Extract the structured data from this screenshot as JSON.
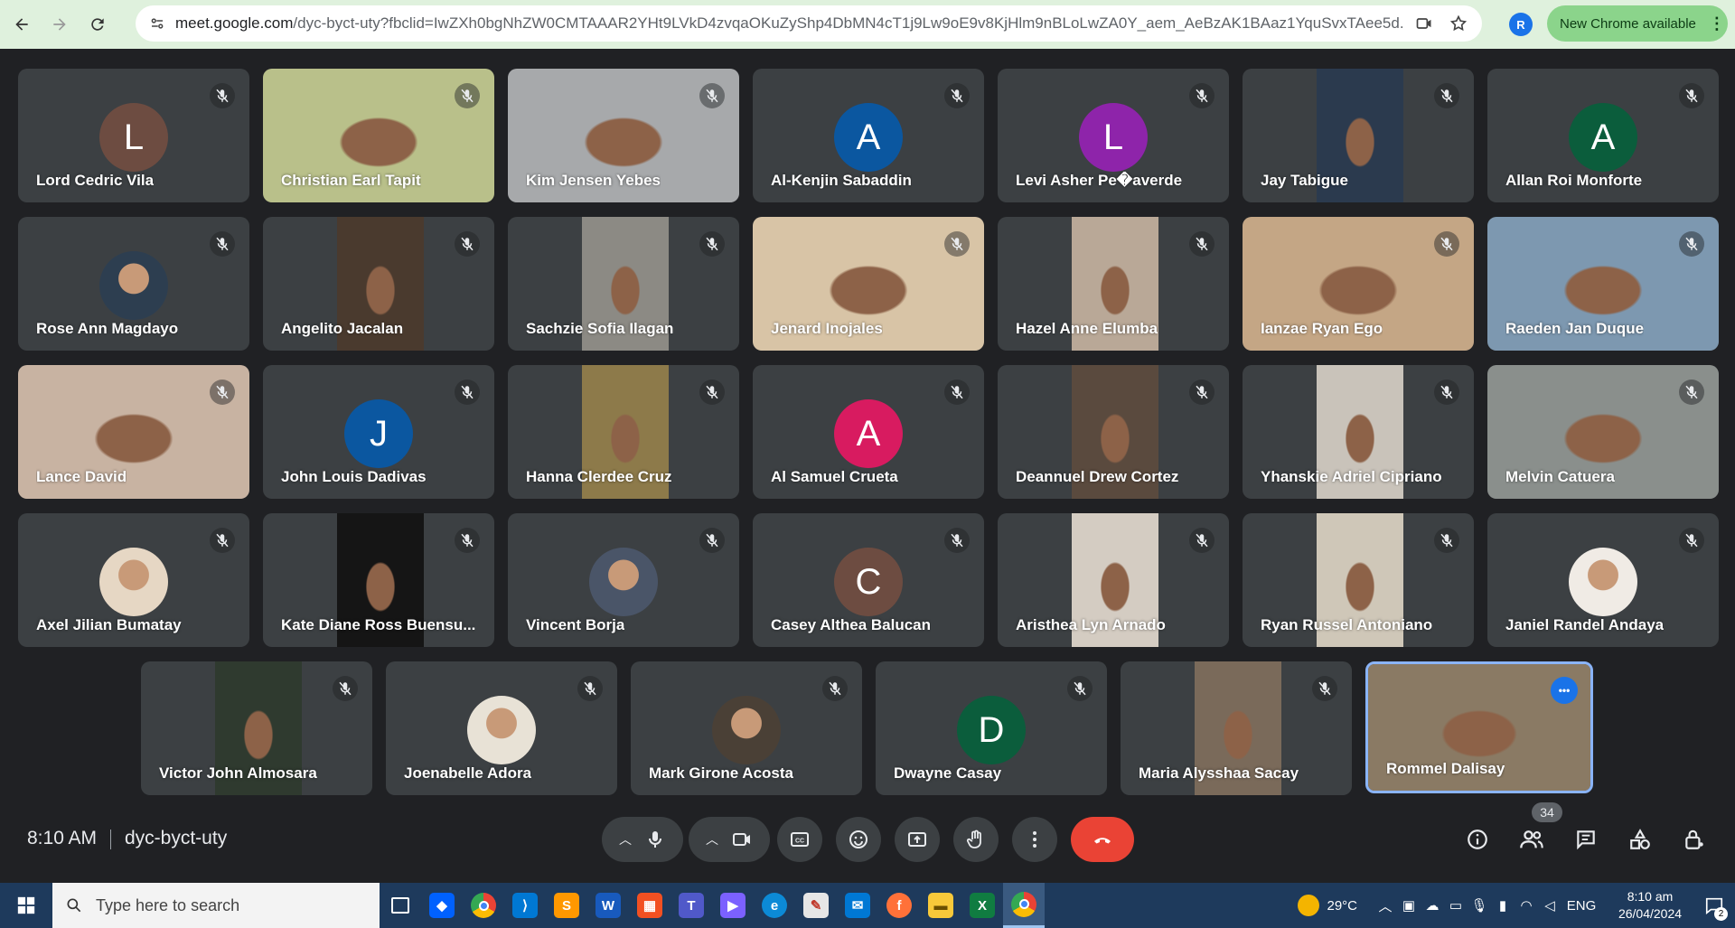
{
  "browser": {
    "url_host": "meet.google.com",
    "url_path": "/dyc-byct-uty?fbclid=IwZXh0bgNhZW0CMTAAAR2YHt9LVkD4zvqaOKuZyShp4DbMN4cT1j9Lw9oE9v8KjHlm9nBLoLwZA0Y_aem_AeBzAK1BAaz1YquSvxTAee5d...",
    "profile_initial": "R",
    "update_label": "New Chrome available"
  },
  "participants": [
    {
      "name": "Lord Cedric Vila",
      "kind": "letter",
      "letter": "L",
      "color": "#6d4c41"
    },
    {
      "name": "Christian Earl Tapit",
      "kind": "video",
      "bg": "#b9c08a"
    },
    {
      "name": "Kim Jensen Yebes",
      "kind": "video",
      "bg": "#a7a9ab"
    },
    {
      "name": "Al-Kenjin Sabaddin",
      "kind": "letter",
      "letter": "A",
      "color": "#0b57a0"
    },
    {
      "name": "Levi Asher Pe�averde",
      "kind": "letter",
      "letter": "L",
      "color": "#8e24aa"
    },
    {
      "name": "Jay Tabigue",
      "kind": "video",
      "bg": "#2b3a4e"
    },
    {
      "name": "Allan Roi Monforte",
      "kind": "letter",
      "letter": "A",
      "color": "#0b5d3c"
    },
    {
      "name": "Rose Ann Magdayo",
      "kind": "photo",
      "bg": "#2d3e50"
    },
    {
      "name": "Angelito Jacalan",
      "kind": "video",
      "bg": "#4a3a2e"
    },
    {
      "name": "Sachzie Sofia Ilagan",
      "kind": "video",
      "bg": "#8c8a84"
    },
    {
      "name": "Jenard Inojales",
      "kind": "video",
      "bg": "#d8c4a6"
    },
    {
      "name": "Hazel Anne Elumba",
      "kind": "video",
      "bg": "#b9a897"
    },
    {
      "name": "Ianzae Ryan Ego",
      "kind": "video",
      "bg": "#c4a685"
    },
    {
      "name": "Raeden Jan Duque",
      "kind": "video",
      "bg": "#7d98b0"
    },
    {
      "name": "Lance David",
      "kind": "video",
      "bg": "#c8b3a2"
    },
    {
      "name": "John Louis Dadivas",
      "kind": "letter",
      "letter": "J",
      "color": "#0b57a0"
    },
    {
      "name": "Hanna Clerdee Cruz",
      "kind": "video",
      "bg": "#8d7a4a"
    },
    {
      "name": "Al Samuel Crueta",
      "kind": "letter",
      "letter": "A",
      "color": "#d81b60"
    },
    {
      "name": "Deannuel Drew Cortez",
      "kind": "video",
      "bg": "#5a4a3e"
    },
    {
      "name": "Yhanskie Adriel Cipriano",
      "kind": "video",
      "bg": "#c9c3ba"
    },
    {
      "name": "Melvin Catuera",
      "kind": "video",
      "bg": "#8a8f8c"
    },
    {
      "name": "Axel Jilian Bumatay",
      "kind": "photo",
      "bg": "#e6d7c4"
    },
    {
      "name": "Kate Diane Ross Buensu...",
      "kind": "video",
      "bg": "#151515"
    },
    {
      "name": "Vincent Borja",
      "kind": "photo",
      "bg": "#4a5568"
    },
    {
      "name": "Casey Althea Balucan",
      "kind": "letter",
      "letter": "C",
      "color": "#6d4c41"
    },
    {
      "name": "Aristhea Lyn Arnado",
      "kind": "video",
      "bg": "#d4ccc2"
    },
    {
      "name": "Ryan Russel Antoniano",
      "kind": "video",
      "bg": "#cfc7b8"
    },
    {
      "name": "Janiel Randel Andaya",
      "kind": "photo",
      "bg": "#f0ebe5"
    },
    {
      "name": "Victor John Almosara",
      "kind": "video",
      "bg": "#2f3a2f"
    },
    {
      "name": "Joenabelle Adora",
      "kind": "photo",
      "bg": "#e8e2d6"
    },
    {
      "name": "Mark Girone Acosta",
      "kind": "photo",
      "bg": "#4a4036"
    },
    {
      "name": "Dwayne Casay",
      "kind": "letter",
      "letter": "D",
      "color": "#0b5d3c"
    },
    {
      "name": "Maria Alysshaa Sacay",
      "kind": "video",
      "bg": "#7a6a5a"
    },
    {
      "name": "Rommel Dalisay",
      "kind": "video",
      "bg": "#8a7a64",
      "self": true
    }
  ],
  "meeting": {
    "time": "8:10 AM",
    "code": "dyc-byct-uty",
    "people_count": "34"
  },
  "taskbar": {
    "search_placeholder": "Type here to search",
    "temperature": "29°C",
    "language": "ENG",
    "time": "8:10 am",
    "date": "26/04/2024",
    "notification_count": "2"
  }
}
